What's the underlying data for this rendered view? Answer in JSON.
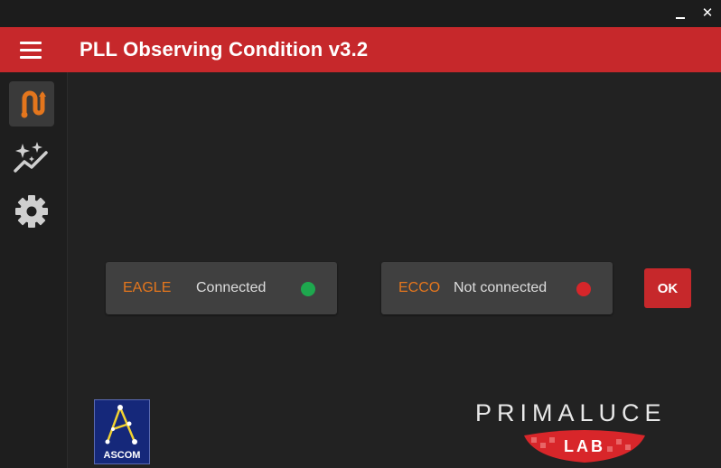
{
  "window": {
    "minimize_label": "_",
    "close_label": "✕"
  },
  "header": {
    "title": "PLL Observing Condition v3.2"
  },
  "sidebar": {
    "items": [
      {
        "icon": "connection-icon",
        "active": true
      },
      {
        "icon": "sparkle-chart-icon",
        "active": false
      },
      {
        "icon": "gear-icon",
        "active": false
      }
    ]
  },
  "devices": [
    {
      "name": "EAGLE",
      "status": "Connected",
      "status_color": "#1ea84e"
    },
    {
      "name": "ECCO",
      "status": "Not connected",
      "status_color": "#d6262a"
    }
  ],
  "ok_button": {
    "label": "OK"
  },
  "logos": {
    "ascom": "ASCOM",
    "primaluce": "PRIMALUCE",
    "lab": "LAB"
  },
  "colors": {
    "accent": "#c6282b",
    "device_name": "#e4761d",
    "background": "#222222",
    "card": "#404040"
  }
}
